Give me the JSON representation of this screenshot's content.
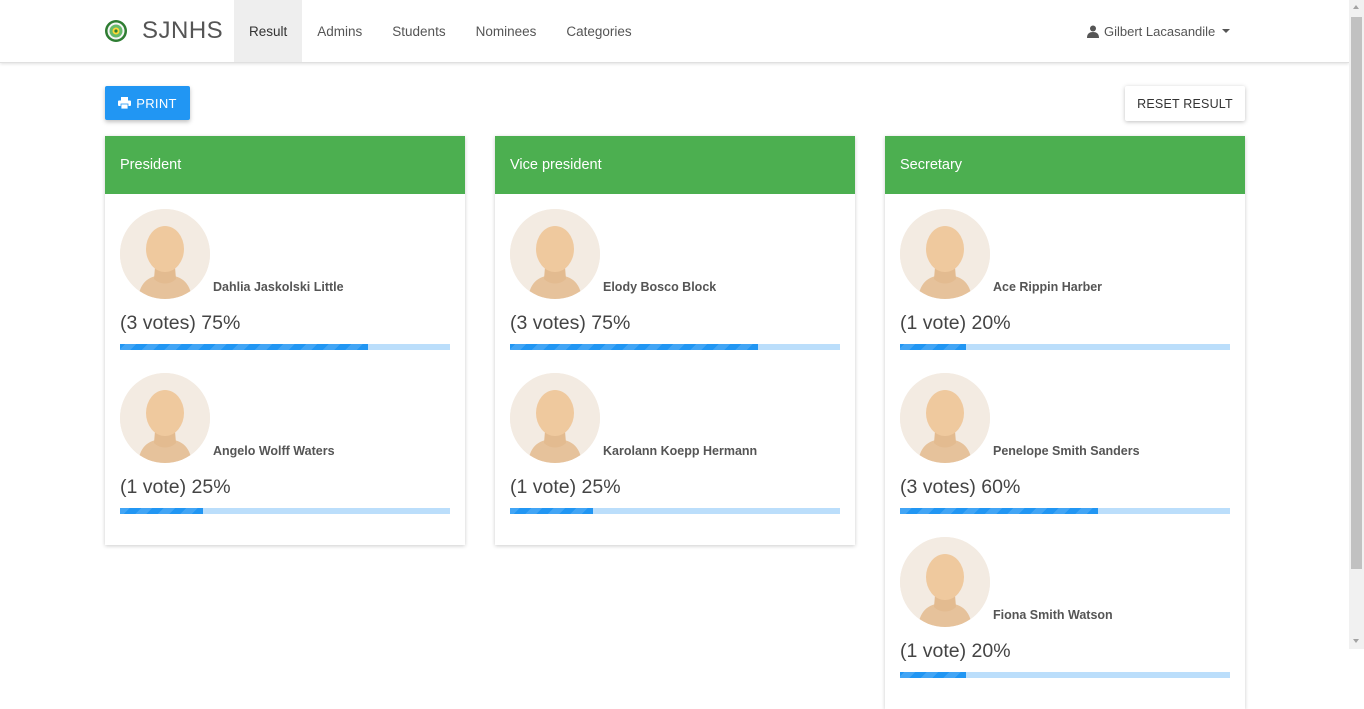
{
  "brand": {
    "name": "SJNHS"
  },
  "nav": {
    "items": [
      {
        "label": "Result",
        "active": true
      },
      {
        "label": "Admins",
        "active": false
      },
      {
        "label": "Students",
        "active": false
      },
      {
        "label": "Nominees",
        "active": false
      },
      {
        "label": "Categories",
        "active": false
      }
    ]
  },
  "user": {
    "name": "Gilbert Lacasandile",
    "icon": "user-icon"
  },
  "toolbar": {
    "print_label": "PRINT",
    "print_icon": "printer-icon",
    "reset_label": "RESET RESULT"
  },
  "colors": {
    "header_green": "#4caf50",
    "primary_blue": "#2196f3",
    "progress_track": "#bbdefb"
  },
  "categories": [
    {
      "title": "President",
      "nominees": [
        {
          "name": "Dahlia Jaskolski Little",
          "votes_text": "(3 votes) 75%",
          "percent": 75
        },
        {
          "name": "Angelo Wolff Waters",
          "votes_text": "(1 vote) 25%",
          "percent": 25
        }
      ]
    },
    {
      "title": "Vice president",
      "nominees": [
        {
          "name": "Elody Bosco Block",
          "votes_text": "(3 votes) 75%",
          "percent": 75
        },
        {
          "name": "Karolann Koepp Hermann",
          "votes_text": "(1 vote) 25%",
          "percent": 25
        }
      ]
    },
    {
      "title": "Secretary",
      "nominees": [
        {
          "name": "Ace Rippin Harber",
          "votes_text": "(1 vote) 20%",
          "percent": 20
        },
        {
          "name": "Penelope Smith Sanders",
          "votes_text": "(3 votes) 60%",
          "percent": 60
        },
        {
          "name": "Fiona Smith Watson",
          "votes_text": "(1 vote) 20%",
          "percent": 20
        }
      ]
    }
  ]
}
